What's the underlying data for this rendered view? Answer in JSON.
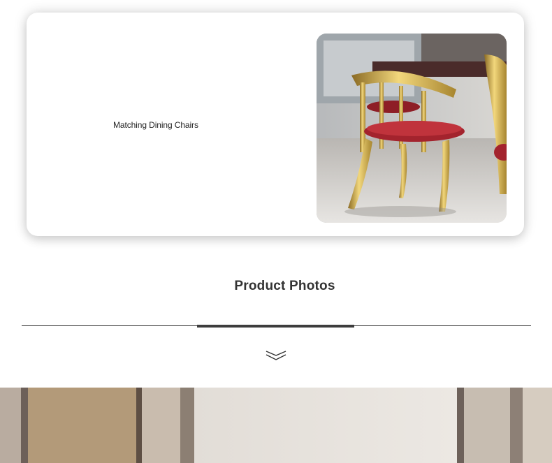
{
  "card": {
    "label": "Matching Dining Chairs",
    "image_alt": "gold chairs with red seats"
  },
  "tabs": {
    "active_label": "Product Photos"
  },
  "icons": {
    "expand": "double-chevron-down-icon"
  },
  "colors": {
    "gold": "#c9a84a",
    "seat_red": "#a3232d",
    "tab_underline": "#3d3d3d"
  }
}
